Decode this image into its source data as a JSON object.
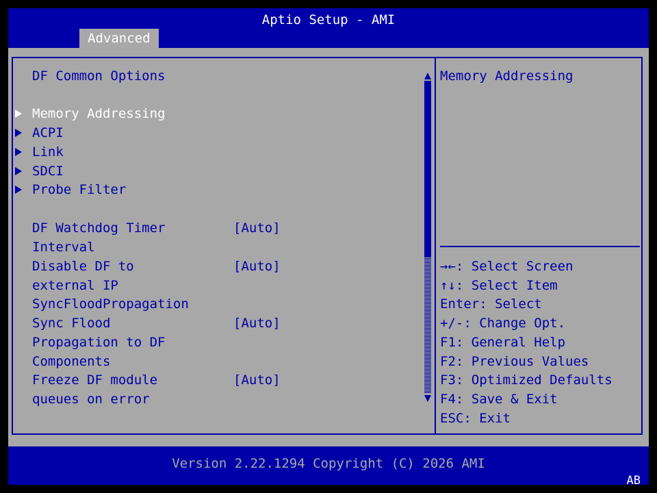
{
  "header": {
    "title": "Aptio Setup - AMI",
    "tab": "Advanced"
  },
  "left": {
    "section_title": "DF Common Options",
    "submenus": [
      {
        "label": "Memory Addressing"
      },
      {
        "label": "ACPI"
      },
      {
        "label": "Link"
      },
      {
        "label": "SDCI"
      },
      {
        "label": "Probe Filter"
      }
    ],
    "settings": [
      {
        "label_lines": [
          "DF Watchdog Timer",
          "Interval"
        ],
        "value": "[Auto]"
      },
      {
        "label_lines": [
          "Disable DF to",
          "external IP",
          "SyncFloodPropagation"
        ],
        "value": "[Auto]"
      },
      {
        "label_lines": [
          "Sync Flood",
          "Propagation to DF",
          "Components"
        ],
        "value": "[Auto]"
      },
      {
        "label_lines": [
          "Freeze DF module",
          "queues on error"
        ],
        "value": "[Auto]"
      }
    ]
  },
  "right": {
    "help_text": "Memory Addressing",
    "keys": [
      {
        "key": "→←",
        "action": ": Select Screen"
      },
      {
        "key": "↑↓",
        "action": ": Select Item"
      },
      {
        "key": "Enter",
        "action": ": Select"
      },
      {
        "key": "+/-",
        "action": ": Change Opt."
      },
      {
        "key": "F1",
        "action": ": General Help"
      },
      {
        "key": "F2",
        "action": ": Previous Values"
      },
      {
        "key": "F3",
        "action": ": Optimized Defaults"
      },
      {
        "key": "F4",
        "action": ": Save & Exit"
      },
      {
        "key": "ESC",
        "action": ": Exit"
      }
    ]
  },
  "footer": {
    "version": "Version 2.22.1294 Copyright (C) 2026 AMI",
    "badge": "AB"
  },
  "colors": {
    "bios_blue": "#0000a8",
    "bios_gray": "#a8a8a8",
    "selected": "#ffffff"
  },
  "scrollbar": {
    "position_fraction": 0.0,
    "visible_fraction": 0.57
  }
}
